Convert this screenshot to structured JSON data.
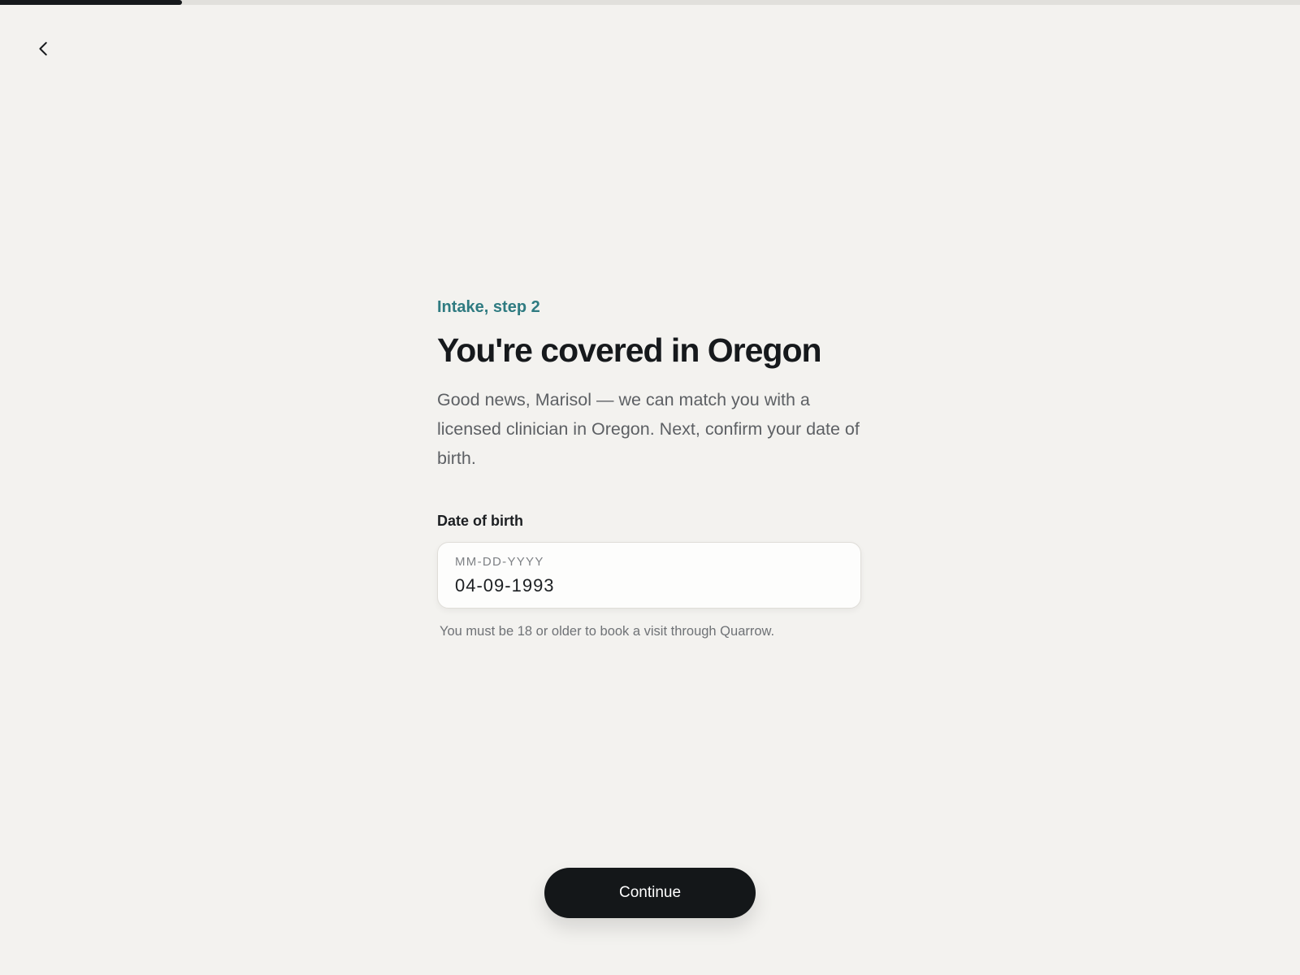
{
  "progress": {
    "fraction": 0.14
  },
  "nav": {
    "back_icon": "chevron-left-icon"
  },
  "header": {
    "eyebrow": "Intake, step 2",
    "title": "You're covered in Oregon",
    "description": "Good news, Marisol — we can match you with a licensed clinician in Oregon. Next, confirm your date of birth."
  },
  "dob_field": {
    "label": "Date of birth",
    "placeholder": "MM-DD-YYYY",
    "value": "04-09-1993",
    "helper": "You must be 18 or older to book a visit through Quarrow."
  },
  "actions": {
    "continue_label": "Continue"
  },
  "colors": {
    "accent": "#2f7b81",
    "background": "#f3f2ef",
    "button": "#141719"
  }
}
